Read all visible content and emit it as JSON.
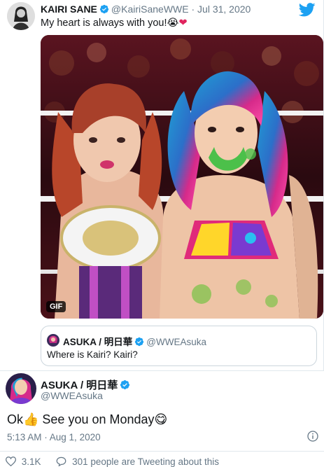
{
  "quoted_tweet": {
    "name": "KAIRI SANE",
    "handle": "@KairiSaneWWE",
    "separator": "·",
    "date": "Jul 31, 2020",
    "text": "My heart is always with you!😭",
    "text_emoji_heart": "❤",
    "media_badge": "GIF",
    "nested_quote": {
      "name": "ASUKA / 明日華",
      "handle": "@WWEAsuka",
      "text": "Where is Kairi? Kairi?"
    }
  },
  "main_tweet": {
    "name": "ASUKA / 明日華",
    "handle": "@WWEAsuka",
    "text": "Ok👍 See you on Monday😋",
    "timestamp": "5:13 AM · Aug 1, 2020",
    "likes": "3.1K",
    "activity": "301 people are Tweeting about this"
  },
  "icons": {
    "verified": "verified-badge-icon",
    "brand": "twitter-bird-icon",
    "info": "info-icon",
    "like": "heart-icon",
    "reply": "speech-bubble-icon"
  },
  "colors": {
    "verified_blue": "#1da1f2",
    "secondary_text": "#657786",
    "heart_red": "#e0245e"
  }
}
